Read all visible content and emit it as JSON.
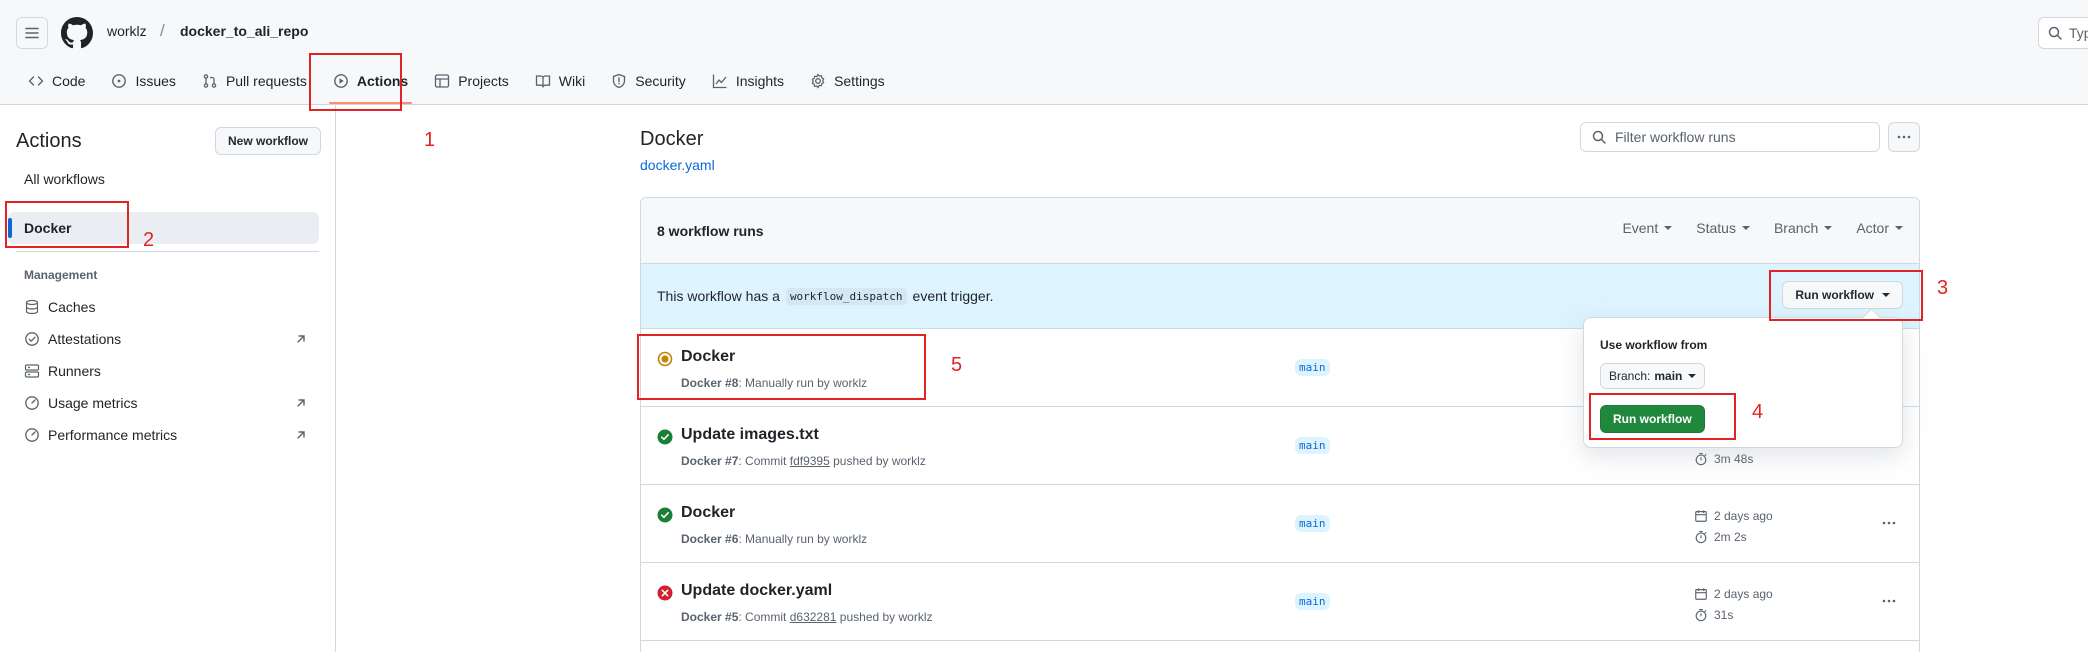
{
  "header": {
    "owner": "worklz",
    "separator": "/",
    "repo": "docker_to_ali_repo",
    "search_text": "Typ"
  },
  "tabs": [
    {
      "label": "Code",
      "icon": "code-icon"
    },
    {
      "label": "Issues",
      "icon": "issue-icon"
    },
    {
      "label": "Pull requests",
      "icon": "pull-request-icon"
    },
    {
      "label": "Actions",
      "icon": "play-icon",
      "selected": true
    },
    {
      "label": "Projects",
      "icon": "table-icon"
    },
    {
      "label": "Wiki",
      "icon": "book-icon"
    },
    {
      "label": "Security",
      "icon": "shield-icon"
    },
    {
      "label": "Insights",
      "icon": "graph-icon"
    },
    {
      "label": "Settings",
      "icon": "gear-icon"
    }
  ],
  "sidebar": {
    "title": "Actions",
    "new_workflow": "New workflow",
    "all_workflows": "All workflows",
    "selected_workflow": "Docker",
    "management_heading": "Management",
    "management_items": [
      {
        "label": "Caches",
        "icon": "database-icon",
        "external": false
      },
      {
        "label": "Attestations",
        "icon": "verified-icon",
        "external": true
      },
      {
        "label": "Runners",
        "icon": "server-icon",
        "external": false
      },
      {
        "label": "Usage metrics",
        "icon": "meter-icon",
        "external": true
      },
      {
        "label": "Performance metrics",
        "icon": "meter-icon",
        "external": true
      }
    ]
  },
  "main": {
    "title": "Docker",
    "file": "docker.yaml",
    "filter_placeholder": "Filter workflow runs",
    "runs_count": "8 workflow runs",
    "filters": [
      "Event",
      "Status",
      "Branch",
      "Actor"
    ],
    "dispatch_prefix": "This workflow has a",
    "dispatch_code": "workflow_dispatch",
    "dispatch_suffix": "event trigger.",
    "run_workflow": "Run workflow",
    "runs": [
      {
        "title": "Docker",
        "status": "in-progress",
        "workflow": "Docker",
        "number": "#8",
        "meta": ": Manually run by worklz",
        "branch": "main",
        "when": "",
        "duration": ""
      },
      {
        "title": "Update images.txt",
        "status": "success",
        "workflow": "Docker",
        "number": "#7",
        "meta_prefix": ": Commit",
        "sha": "fdf9395",
        "meta_suffix": "pushed by worklz",
        "branch": "main",
        "when": "",
        "duration": "3m 48s"
      },
      {
        "title": "Docker",
        "status": "success",
        "workflow": "Docker",
        "number": "#6",
        "meta": ": Manually run by worklz",
        "branch": "main",
        "when": "2 days ago",
        "duration": "2m 2s"
      },
      {
        "title": "Update docker.yaml",
        "status": "failure",
        "workflow": "Docker",
        "number": "#5",
        "meta_prefix": ": Commit",
        "sha": "d632281",
        "meta_suffix": "pushed by worklz",
        "branch": "main",
        "when": "2 days ago",
        "duration": "31s"
      }
    ]
  },
  "popover": {
    "label": "Use workflow from",
    "branch_prefix": "Branch:",
    "branch_value": "main",
    "run_button": "Run workflow"
  },
  "annotations": [
    "1",
    "2",
    "3",
    "4",
    "5"
  ],
  "colors": {
    "accent": "#0969da",
    "success": "#1a7f37",
    "failure": "#cf222e",
    "in_progress": "#bf8700",
    "annotation": "#e02424",
    "primary_button": "#1f883d"
  }
}
